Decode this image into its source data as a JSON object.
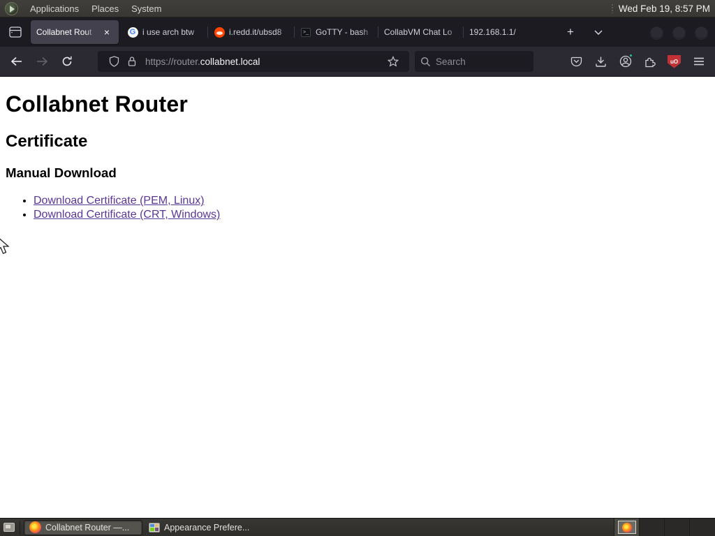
{
  "top_panel": {
    "menus": [
      "Applications",
      "Places",
      "System"
    ],
    "clock": "Wed Feb 19, 8:57 PM"
  },
  "tab_bar": {
    "tabs": [
      {
        "title": "Collabnet Rout",
        "close_label": "×"
      },
      {
        "title": "i use arch btw"
      },
      {
        "title": "i.redd.it/ubsd8"
      },
      {
        "title": "GoTTY - bash"
      },
      {
        "title": "CollabVM Chat Lo"
      },
      {
        "title": "192.168.1.1/"
      }
    ],
    "new_tab_label": "+",
    "favicon_google_letter": "G",
    "favicon_terminal_glyph": ">_"
  },
  "toolbar": {
    "url_prefix": "https://router.",
    "url_domain": "collabnet.local",
    "search_placeholder": "Search"
  },
  "page": {
    "title_h1": "Collabnet Router",
    "title_h2": "Certificate",
    "title_h3": "Manual Download",
    "links": [
      "Download Certificate (PEM, Linux)",
      "Download Certificate (CRT, Windows)"
    ]
  },
  "taskbar": {
    "tasks": [
      {
        "label": "Collabnet Router —..."
      },
      {
        "label": "Appearance Prefere..."
      }
    ]
  },
  "colors": {
    "visited_link": "#5a3696",
    "panel_bg": "#3a3936",
    "tabbar_bg": "#1c1b22",
    "active_tab_bg": "#42414d",
    "toolbar_bg": "#2b2a33",
    "field_bg": "#1c1b22",
    "ublock_red": "#c13237",
    "account_badge_teal": "#2ac3a2",
    "reddit_orange": "#ff4500"
  }
}
